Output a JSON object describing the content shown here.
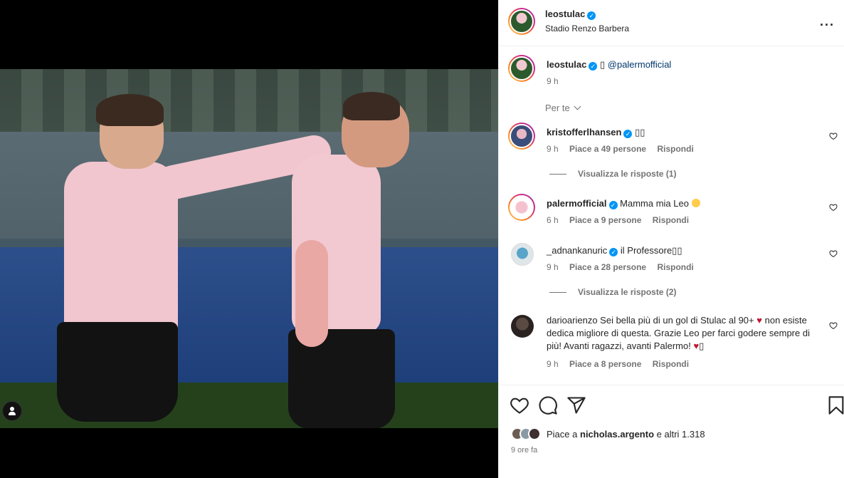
{
  "post": {
    "author": "leostulac",
    "location": "Stadio Renzo Barbera",
    "caption_mention": "@palermofficial",
    "caption_glyph": "▯",
    "time": "9 h",
    "sort_label": "Per te"
  },
  "comments": [
    {
      "user": "kristofferlhansen",
      "verified": true,
      "text": "▯▯",
      "time": "9 h",
      "likes": "Piace a 49 persone",
      "reply": "Rispondi",
      "view_replies": "Visualizza le risposte (1)"
    },
    {
      "user": "palermofficial",
      "verified": true,
      "text": "Mamma mia Leo",
      "time": "6 h",
      "likes": "Piace a 9 persone",
      "reply": "Rispondi"
    },
    {
      "user": "_adnankanuric",
      "verified": true,
      "text": "il Professore▯▯",
      "time": "9 h",
      "likes": "Piace a 28 persone",
      "reply": "Rispondi",
      "view_replies": "Visualizza le risposte (2)"
    },
    {
      "user": "darioarienzo",
      "verified": false,
      "text_a": "Sei bella più di un gol di Stulac al 90+",
      "text_b": "non esiste dedica migliore di questa. Grazie Leo per farci godere sempre di più! Avanti ragazzi, avanti Palermo!",
      "text_c": "▯",
      "time": "9 h",
      "likes": "Piace a 8 persone",
      "reply": "Rispondi"
    }
  ],
  "likes_summary": {
    "prefix": "Piace a",
    "user": "nicholas.argento",
    "suffix": "e altri 1.318"
  },
  "time_ago": "9 ore fa",
  "icons": {
    "more": "more-icon",
    "like": "heart-icon",
    "comment": "comment-icon",
    "share": "send-icon",
    "save": "bookmark-icon",
    "tag": "user-tag-icon"
  },
  "colors": {
    "verified": "#0095f6",
    "muted": "#737373",
    "text": "#262626"
  }
}
